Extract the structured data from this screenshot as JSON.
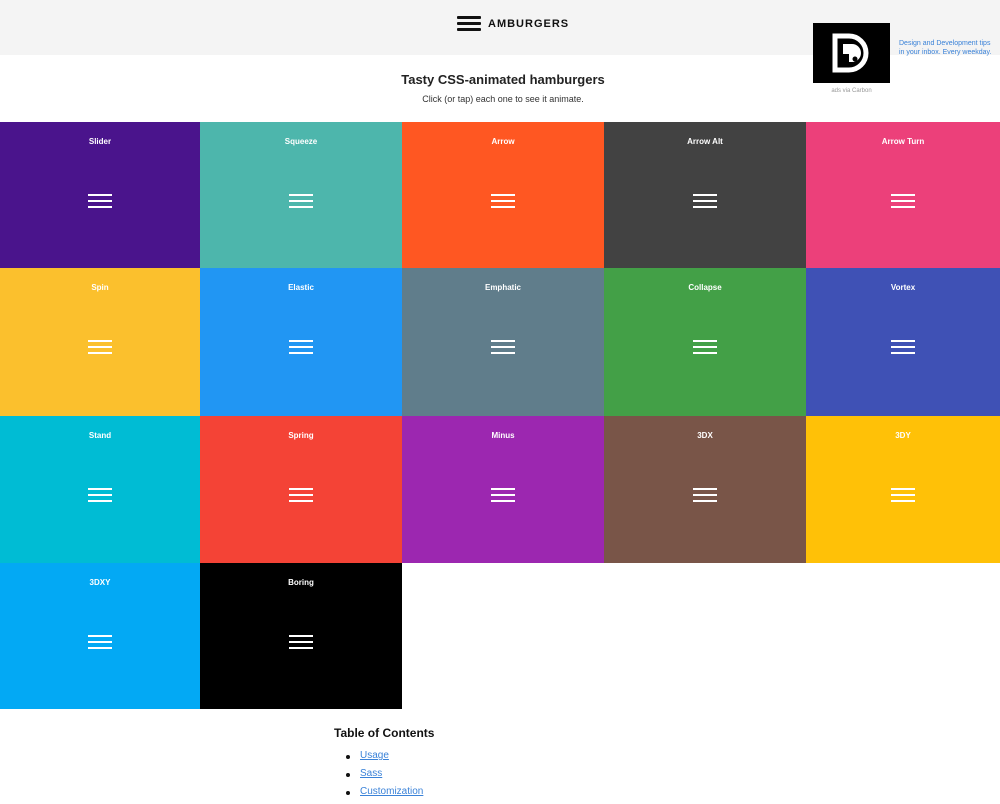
{
  "header": {
    "brand_text": "AMBURGERS",
    "brand_icon": "hamburger-icon"
  },
  "ad": {
    "logo_icon": "dd-logo-icon",
    "text": "Design and Development tips in your inbox. Every weekday.",
    "via": "ads via Carbon",
    "logo_bg": "#000000"
  },
  "hero": {
    "title": "Tasty CSS-animated hamburgers",
    "subtitle": "Click (or tap) each one to see it animate."
  },
  "tiles": [
    {
      "label": "Slider",
      "color": "#4a148c"
    },
    {
      "label": "Squeeze",
      "color": "#4db6ac"
    },
    {
      "label": "Arrow",
      "color": "#ff5722"
    },
    {
      "label": "Arrow Alt",
      "color": "#424242"
    },
    {
      "label": "Arrow Turn",
      "color": "#ec407a"
    },
    {
      "label": "Spin",
      "color": "#fbc02d"
    },
    {
      "label": "Elastic",
      "color": "#2196f3"
    },
    {
      "label": "Emphatic",
      "color": "#607d8b"
    },
    {
      "label": "Collapse",
      "color": "#43a047"
    },
    {
      "label": "Vortex",
      "color": "#3f51b5"
    },
    {
      "label": "Stand",
      "color": "#00bcd4"
    },
    {
      "label": "Spring",
      "color": "#f44336"
    },
    {
      "label": "Minus",
      "color": "#9c27b0"
    },
    {
      "label": "3DX",
      "color": "#795548"
    },
    {
      "label": "3DY",
      "color": "#ffc107"
    },
    {
      "label": "3DXY",
      "color": "#03a9f4"
    },
    {
      "label": "Boring",
      "color": "#000000"
    }
  ],
  "toc": {
    "title": "Table of Contents",
    "items": [
      "Usage",
      "Sass",
      "Customization"
    ]
  },
  "colors": {
    "link": "#3a82d8",
    "topbar": "#f4f4f4"
  }
}
